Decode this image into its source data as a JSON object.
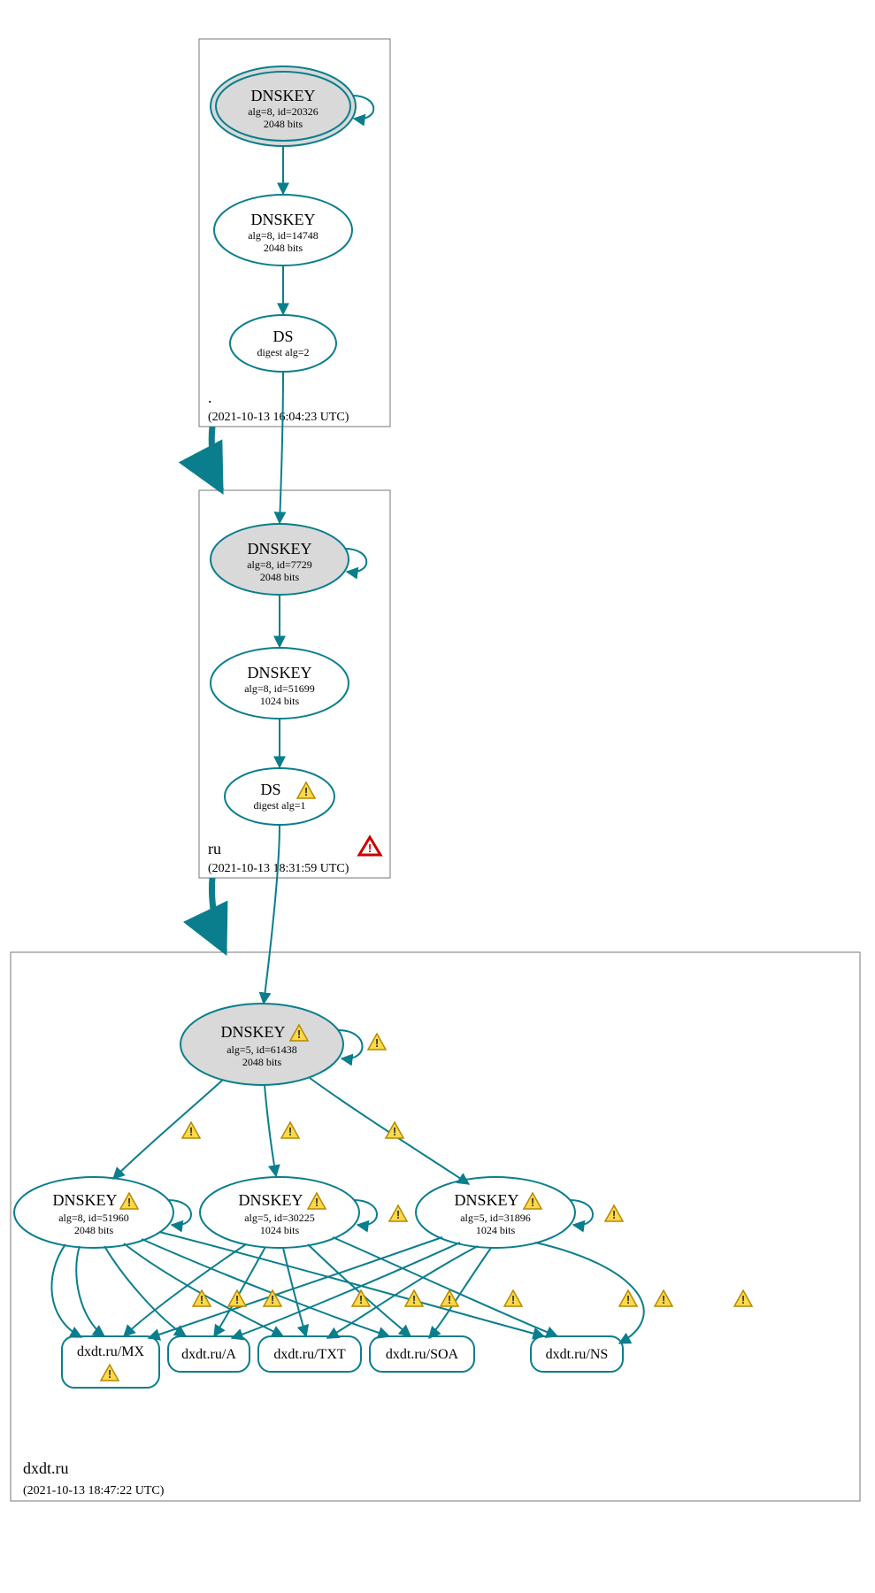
{
  "colors": {
    "stroke": "#0a7e8c",
    "fill_gray": "#d9d9d9",
    "warn_fill": "#ffd94a",
    "warn_stroke": "#b58900",
    "err_stroke": "#cc0000"
  },
  "zones": {
    "root": {
      "label": ".",
      "timestamp": "(2021-10-13 16:04:23 UTC)",
      "nodes": {
        "dnskey1": {
          "title": "DNSKEY",
          "sub1": "alg=8, id=20326",
          "sub2": "2048 bits"
        },
        "dnskey2": {
          "title": "DNSKEY",
          "sub1": "alg=8, id=14748",
          "sub2": "2048 bits"
        },
        "ds": {
          "title": "DS",
          "sub1": "digest alg=2"
        }
      }
    },
    "ru": {
      "label": "ru",
      "timestamp": "(2021-10-13 18:31:59 UTC)",
      "nodes": {
        "dnskey1": {
          "title": "DNSKEY",
          "sub1": "alg=8, id=7729",
          "sub2": "2048 bits"
        },
        "dnskey2": {
          "title": "DNSKEY",
          "sub1": "alg=8, id=51699",
          "sub2": "1024 bits"
        },
        "ds": {
          "title": "DS",
          "sub1": "digest alg=1"
        }
      }
    },
    "dxdt": {
      "label": "dxdt.ru",
      "timestamp": "(2021-10-13 18:47:22 UTC)",
      "nodes": {
        "dnskey1": {
          "title": "DNSKEY",
          "sub1": "alg=5, id=61438",
          "sub2": "2048 bits"
        },
        "dnskey2": {
          "title": "DNSKEY",
          "sub1": "alg=8, id=51960",
          "sub2": "2048 bits"
        },
        "dnskey3": {
          "title": "DNSKEY",
          "sub1": "alg=5, id=30225",
          "sub2": "1024 bits"
        },
        "dnskey4": {
          "title": "DNSKEY",
          "sub1": "alg=5, id=31896",
          "sub2": "1024 bits"
        },
        "rr_mx": {
          "label": "dxdt.ru/MX"
        },
        "rr_a": {
          "label": "dxdt.ru/A"
        },
        "rr_txt": {
          "label": "dxdt.ru/TXT"
        },
        "rr_soa": {
          "label": "dxdt.ru/SOA"
        },
        "rr_ns": {
          "label": "dxdt.ru/NS"
        }
      }
    }
  }
}
